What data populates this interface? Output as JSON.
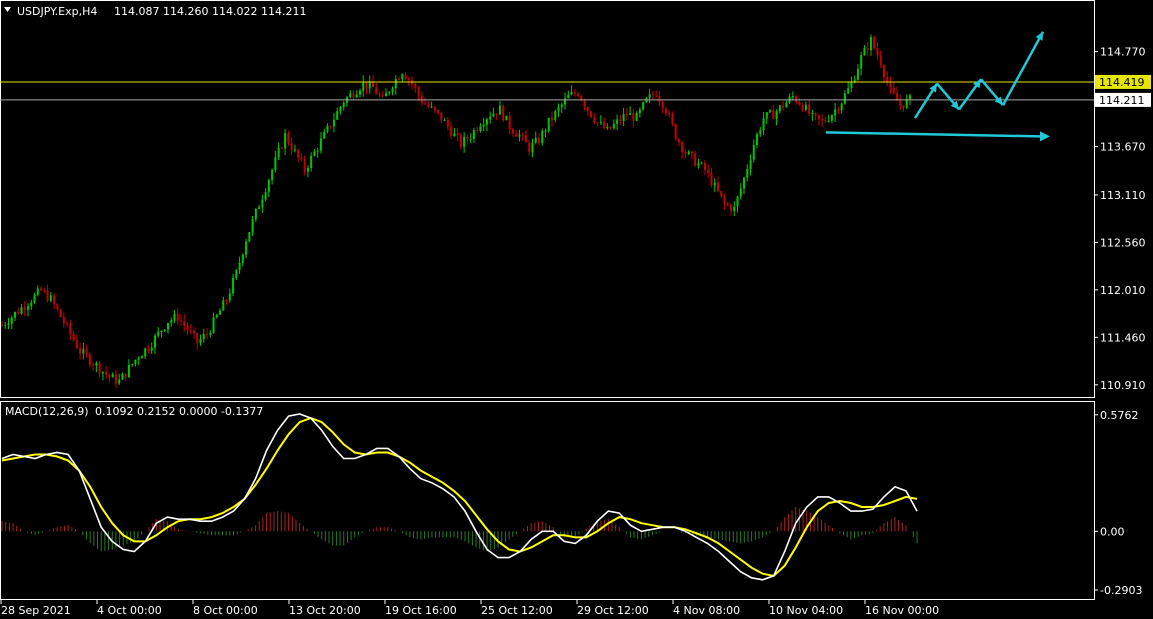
{
  "window": {
    "symbol_title": "USDJPY.Exp,H4",
    "ohlc": "114.087 114.260 114.022 114.211",
    "macd_title": "MACD(12,26,9)",
    "macd_values": "0.1092 0.2152 0.0000 -0.1377"
  },
  "colors": {
    "background": "#000000",
    "grid_frame": "#ffffff",
    "bull_candle": "#00c800",
    "bear_candle": "#c80000",
    "level_line": "#e6e600",
    "price_line": "#aaaaaa",
    "arrow": "#20c8d8",
    "macd_main": "#ffffff",
    "macd_signal": "#ffff00",
    "hist_pos": "#b02020",
    "hist_neg": "#2a7a2a"
  },
  "chart_data": [
    {
      "type": "candlestick",
      "title": "USDJPY.Exp,H4",
      "y_ticks": [
        "114.770",
        "113.670",
        "113.110",
        "112.560",
        "112.010",
        "111.460",
        "110.910"
      ],
      "ylim": [
        110.78,
        115.16
      ],
      "level_line": {
        "value": 114.419,
        "label": "114.419"
      },
      "current_price": {
        "value": 114.211,
        "label": "114.211"
      },
      "x_ticks": [
        "28 Sep 2021",
        "4 Oct 00:00",
        "8 Oct 00:00",
        "13 Oct 20:00",
        "19 Oct 16:00",
        "25 Oct 12:00",
        "29 Oct 12:00",
        "4 Nov 08:00",
        "10 Nov 04:00",
        "16 Nov 00:00"
      ],
      "close_series": [
        111.6,
        111.7,
        111.8,
        111.9,
        112.0,
        111.9,
        111.7,
        111.5,
        111.3,
        111.2,
        111.1,
        111.0,
        110.95,
        111.1,
        111.25,
        111.35,
        111.5,
        111.65,
        111.7,
        111.55,
        111.4,
        111.5,
        111.7,
        111.9,
        112.2,
        112.6,
        112.9,
        113.2,
        113.5,
        113.8,
        113.6,
        113.4,
        113.6,
        113.8,
        114.0,
        114.2,
        114.3,
        114.4,
        114.35,
        114.2,
        114.4,
        114.55,
        114.4,
        114.2,
        114.1,
        114.0,
        113.85,
        113.7,
        113.8,
        113.95,
        114.05,
        114.1,
        113.9,
        113.8,
        113.65,
        113.75,
        113.95,
        114.1,
        114.25,
        114.3,
        114.1,
        113.95,
        113.85,
        113.95,
        114.05,
        114.0,
        114.2,
        114.3,
        114.1,
        113.8,
        113.6,
        113.5,
        113.4,
        113.2,
        113.0,
        112.95,
        113.3,
        113.7,
        114.0,
        114.05,
        114.15,
        114.25,
        114.15,
        114.0,
        113.95,
        114.05,
        114.2,
        114.4,
        114.7,
        114.9,
        114.65,
        114.3,
        114.15,
        114.21
      ],
      "projection_arrows": [
        {
          "from": [
            114.0,
            1
          ],
          "to": [
            114.4,
            2
          ]
        },
        {
          "from": [
            114.4,
            2
          ],
          "to": [
            114.1,
            3
          ]
        },
        {
          "from": [
            114.1,
            3
          ],
          "to": [
            114.45,
            4
          ]
        },
        {
          "from": [
            114.45,
            4
          ],
          "to": [
            114.15,
            5
          ]
        },
        {
          "from": [
            114.15,
            5
          ],
          "to": [
            115.0,
            6
          ]
        }
      ],
      "support_arrow_value": 113.8
    },
    {
      "type": "macd",
      "title": "MACD(12,26,9)",
      "y_ticks": [
        "0.5762",
        "0.00",
        "-0.2903"
      ],
      "ylim": [
        -0.33,
        0.6
      ],
      "main": [
        0.36,
        0.38,
        0.37,
        0.36,
        0.38,
        0.39,
        0.38,
        0.3,
        0.16,
        0.02,
        -0.05,
        -0.09,
        -0.1,
        -0.05,
        0.04,
        0.07,
        0.06,
        0.06,
        0.05,
        0.05,
        0.07,
        0.1,
        0.16,
        0.26,
        0.4,
        0.5,
        0.57,
        0.58,
        0.56,
        0.5,
        0.42,
        0.36,
        0.36,
        0.38,
        0.41,
        0.41,
        0.37,
        0.31,
        0.26,
        0.24,
        0.21,
        0.17,
        0.1,
        0.0,
        -0.09,
        -0.13,
        -0.13,
        -0.1,
        -0.04,
        0.0,
        0.0,
        -0.05,
        -0.06,
        -0.02,
        0.05,
        0.1,
        0.09,
        0.03,
        0.0,
        0.01,
        0.02,
        0.02,
        0.0,
        -0.03,
        -0.06,
        -0.1,
        -0.15,
        -0.2,
        -0.23,
        -0.24,
        -0.22,
        -0.1,
        0.04,
        0.12,
        0.17,
        0.17,
        0.14,
        0.1,
        0.1,
        0.11,
        0.17,
        0.22,
        0.2,
        0.1
      ],
      "signal": [
        0.35,
        0.36,
        0.37,
        0.38,
        0.38,
        0.37,
        0.35,
        0.3,
        0.22,
        0.12,
        0.04,
        -0.02,
        -0.05,
        -0.05,
        -0.02,
        0.02,
        0.05,
        0.06,
        0.06,
        0.07,
        0.09,
        0.12,
        0.16,
        0.23,
        0.31,
        0.4,
        0.48,
        0.54,
        0.56,
        0.54,
        0.49,
        0.43,
        0.39,
        0.38,
        0.39,
        0.39,
        0.37,
        0.34,
        0.3,
        0.27,
        0.24,
        0.2,
        0.15,
        0.08,
        0.01,
        -0.05,
        -0.09,
        -0.1,
        -0.08,
        -0.05,
        -0.02,
        -0.02,
        -0.03,
        -0.03,
        0.0,
        0.04,
        0.07,
        0.06,
        0.04,
        0.03,
        0.02,
        0.02,
        0.01,
        -0.01,
        -0.03,
        -0.06,
        -0.1,
        -0.14,
        -0.18,
        -0.21,
        -0.22,
        -0.17,
        -0.08,
        0.02,
        0.1,
        0.14,
        0.15,
        0.14,
        0.12,
        0.12,
        0.13,
        0.15,
        0.17,
        0.16
      ],
      "histogram": [
        0.05,
        0.04,
        0.0,
        -0.02,
        0.0,
        0.02,
        0.03,
        0.0,
        -0.06,
        -0.1,
        -0.09,
        -0.07,
        -0.05,
        0.0,
        0.06,
        0.05,
        0.01,
        0.0,
        -0.01,
        -0.02,
        -0.02,
        -0.02,
        0.0,
        0.03,
        0.09,
        0.1,
        0.09,
        0.04,
        0.0,
        -0.04,
        -0.07,
        -0.07,
        -0.03,
        0.0,
        0.02,
        0.02,
        0.0,
        -0.03,
        -0.04,
        -0.03,
        -0.03,
        -0.03,
        -0.05,
        -0.08,
        -0.1,
        -0.08,
        -0.04,
        0.0,
        0.04,
        0.05,
        0.02,
        -0.03,
        -0.03,
        0.01,
        0.05,
        0.06,
        0.02,
        -0.03,
        -0.04,
        -0.02,
        0.0,
        0.0,
        -0.01,
        -0.02,
        -0.03,
        -0.04,
        -0.05,
        -0.06,
        -0.05,
        -0.03,
        0.0,
        0.07,
        0.12,
        0.1,
        0.07,
        0.03,
        -0.01,
        -0.04,
        -0.02,
        -0.01,
        0.04,
        0.07,
        0.03,
        -0.06
      ]
    }
  ]
}
